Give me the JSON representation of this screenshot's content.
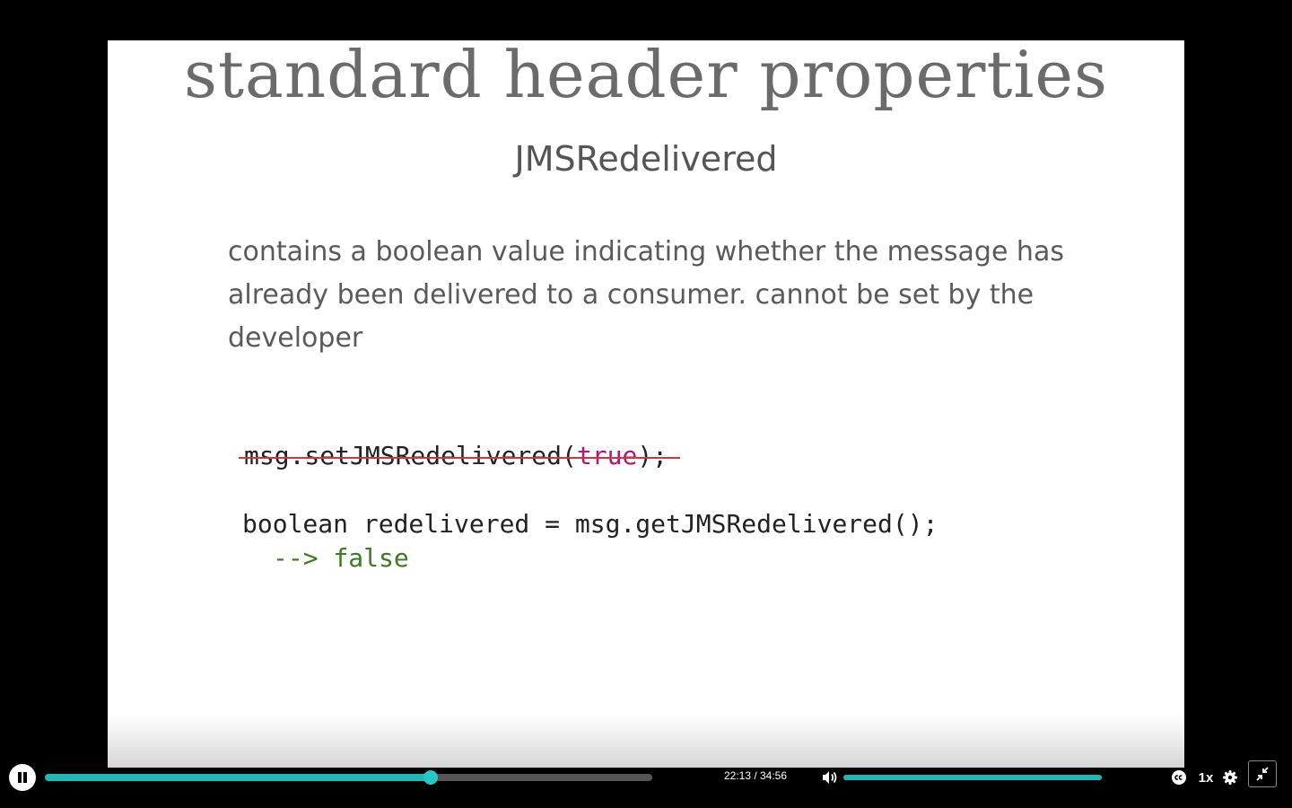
{
  "slide": {
    "title": "standard header properties",
    "subtitle": "JMSRedelivered",
    "description": "contains a boolean value indicating whether the message has already been delivered to a consumer. cannot be set by the developer",
    "code_strike_prefix": "msg.setJMSRedelivered(",
    "code_strike_keyword": "true",
    "code_strike_suffix": ");",
    "code_get": "boolean redelivered = msg.getJMSRedelivered();",
    "code_arrow": "-->",
    "code_result": "false"
  },
  "player": {
    "time_display": "22:13 / 34:56",
    "progress": 0.6355,
    "volume": 1.0,
    "speed_label": "1x",
    "icons": {
      "pause": "pause-icon",
      "volume": "volume-icon",
      "cc": "closed-captions-icon",
      "settings": "gear-icon",
      "exit_fullscreen": "exit-fullscreen-icon"
    },
    "colors": {
      "accent": "#22b7b7"
    }
  }
}
